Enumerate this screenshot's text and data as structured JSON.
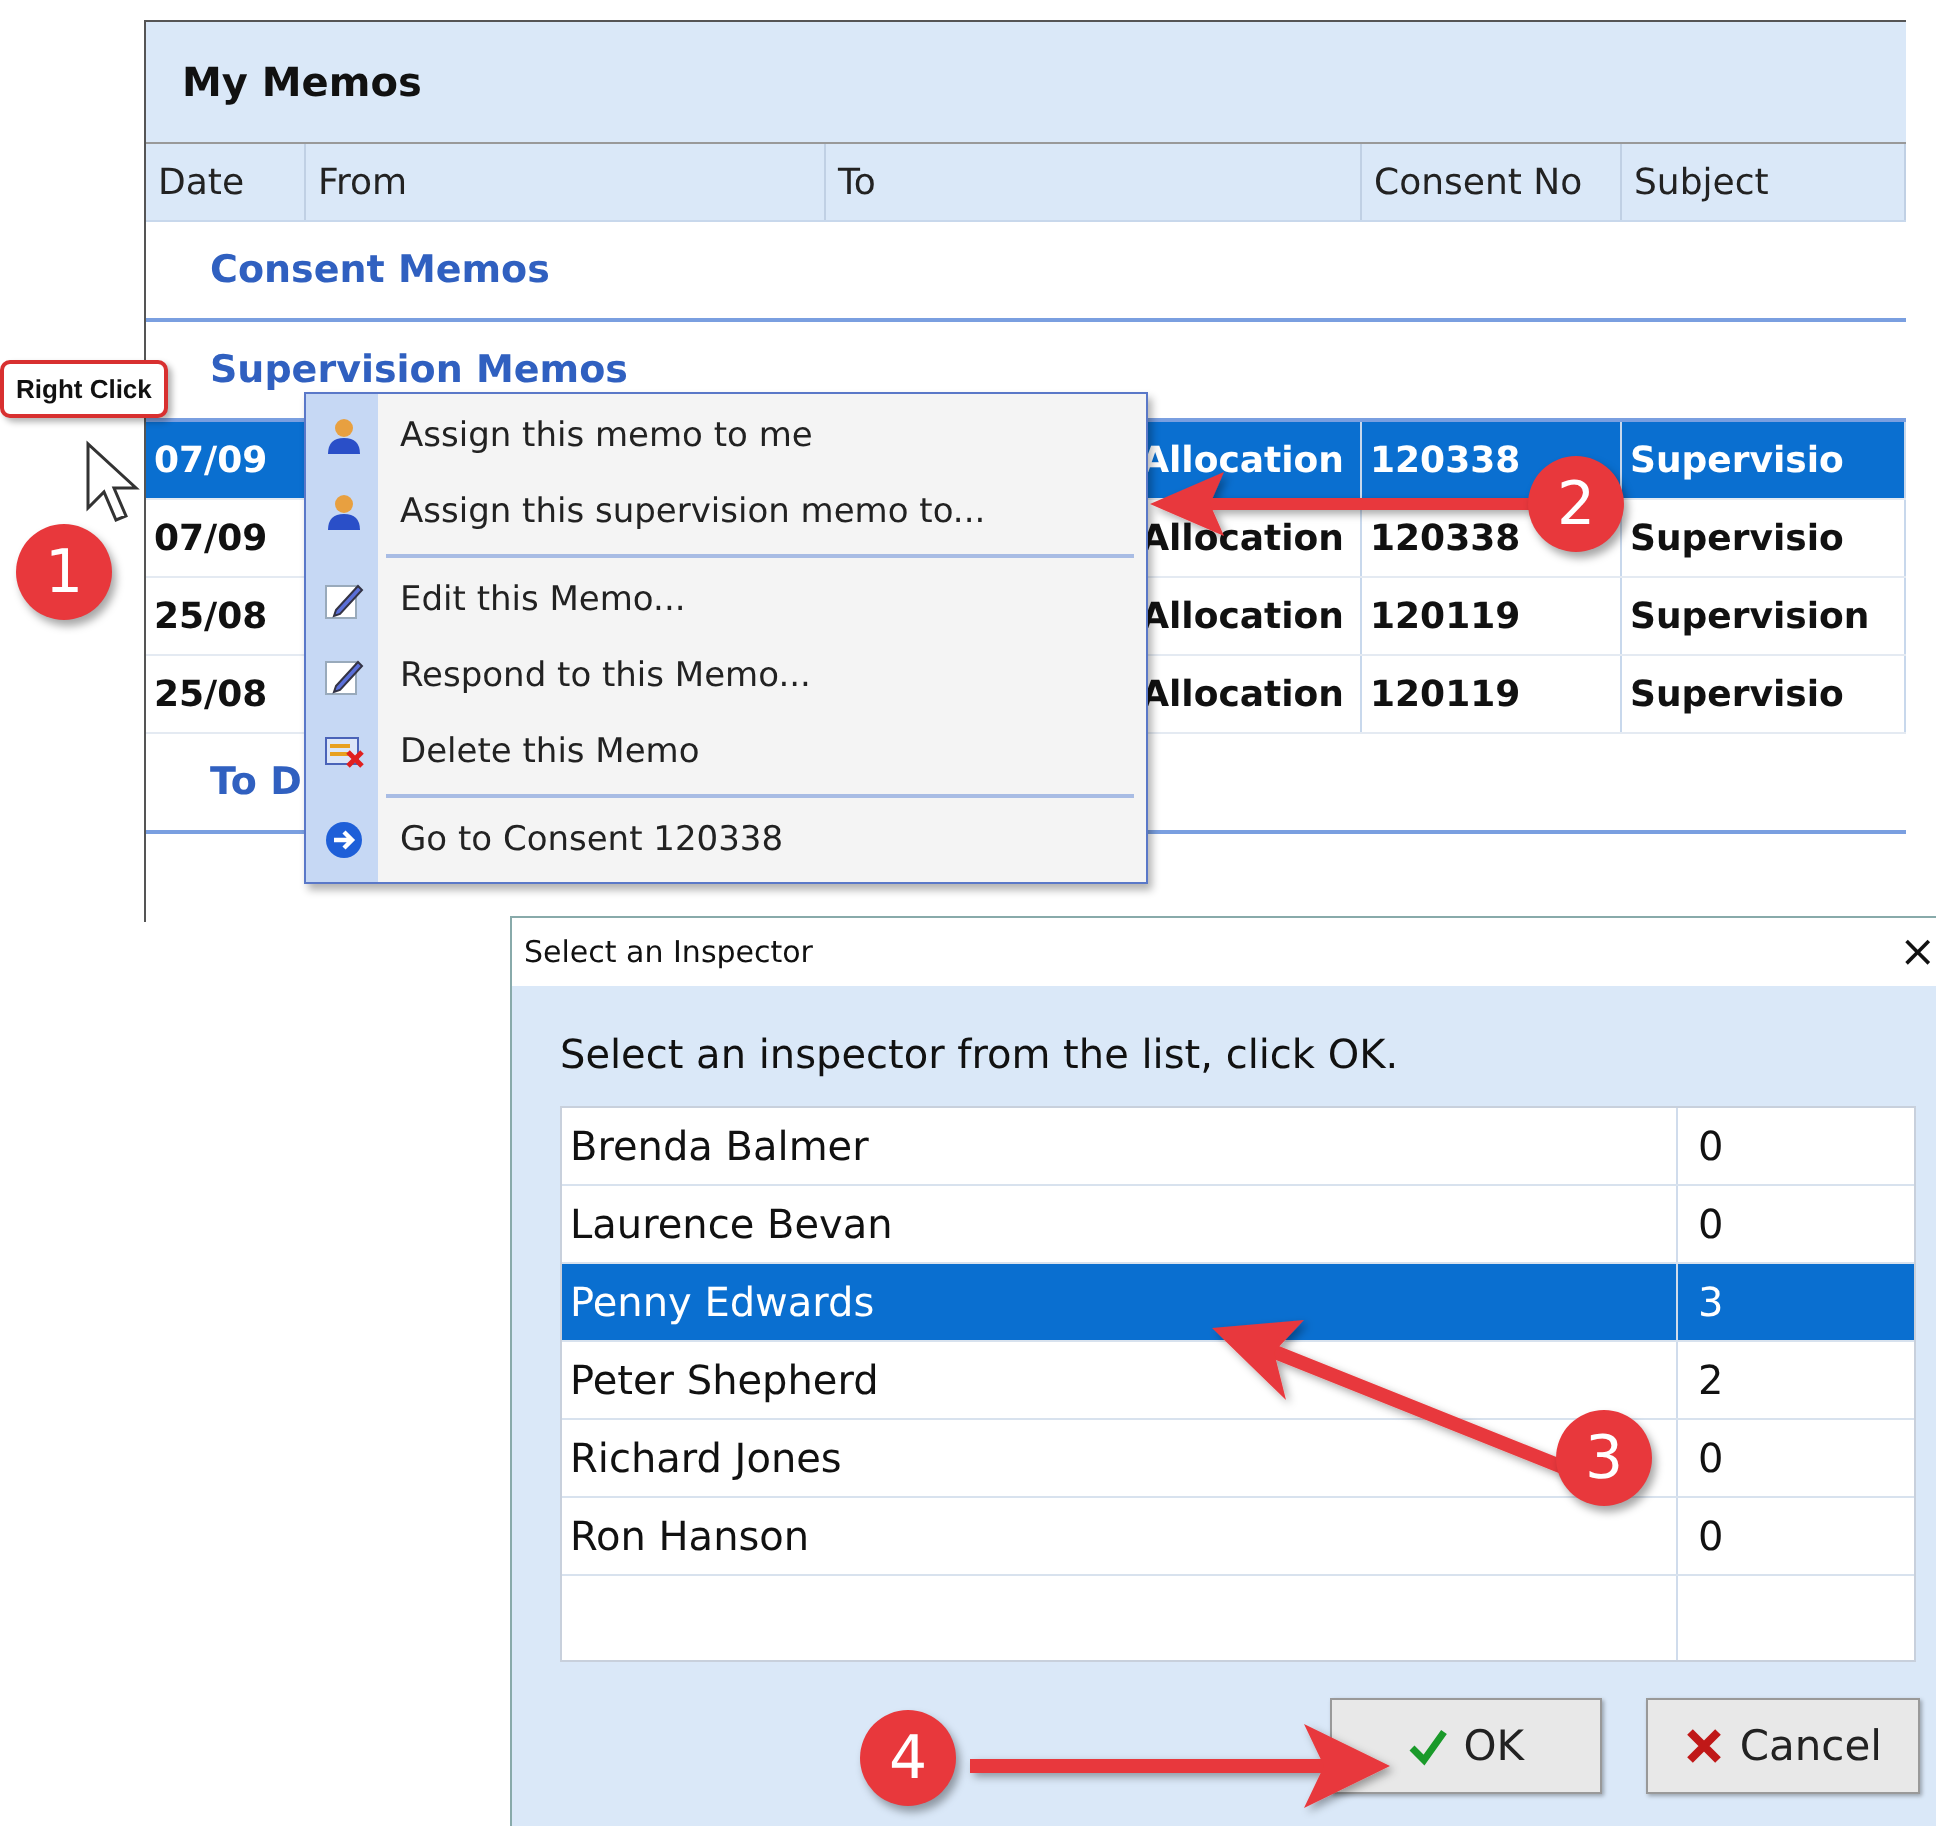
{
  "memos_panel": {
    "title": "My Memos",
    "columns": [
      "Date",
      "From",
      "To",
      "Consent No",
      "Subject"
    ],
    "groups": [
      {
        "label": "Consent Memos"
      },
      {
        "label": "Supervision Memos"
      }
    ],
    "rows": [
      {
        "date": "07/09",
        "to": "Allocation",
        "consent_no": "120338",
        "subject": "Supervisio",
        "selected": true
      },
      {
        "date": "07/09",
        "to": "Allocation",
        "consent_no": "120338",
        "subject": "Supervisio",
        "selected": false
      },
      {
        "date": "25/08",
        "to": "Allocation",
        "consent_no": "120119",
        "subject": "Supervision",
        "selected": false
      },
      {
        "date": "25/08",
        "to": "Allocation",
        "consent_no": "120119",
        "subject": "Supervisio",
        "selected": false
      }
    ],
    "trailing_group": "To D"
  },
  "context_menu": {
    "items": [
      {
        "kind": "person",
        "label": "Assign this memo to me"
      },
      {
        "kind": "person",
        "label": "Assign this supervision memo to..."
      },
      {
        "kind": "separator"
      },
      {
        "kind": "pencil",
        "label": "Edit this Memo..."
      },
      {
        "kind": "pencil",
        "label": "Respond to this Memo..."
      },
      {
        "kind": "delete",
        "label": "Delete this Memo"
      },
      {
        "kind": "separator"
      },
      {
        "kind": "goto",
        "label": "Go to Consent 120338"
      }
    ]
  },
  "dialog": {
    "title": "Select an Inspector",
    "close": "×",
    "instruction": "Select an inspector from the list, click OK.",
    "inspectors": [
      {
        "name": "Brenda Balmer",
        "count": "0",
        "selected": false
      },
      {
        "name": "Laurence Bevan",
        "count": "0",
        "selected": false
      },
      {
        "name": "Penny Edwards",
        "count": "3",
        "selected": true
      },
      {
        "name": "Peter Shepherd",
        "count": "2",
        "selected": false
      },
      {
        "name": "Richard Jones",
        "count": "0",
        "selected": false
      },
      {
        "name": "Ron Hanson",
        "count": "0",
        "selected": false
      }
    ],
    "buttons": [
      {
        "kind": "ok",
        "label": "OK"
      },
      {
        "kind": "cancel",
        "label": "Cancel"
      }
    ]
  },
  "annotations": {
    "callout": "Right Click",
    "steps": [
      "1",
      "2",
      "3",
      "4"
    ]
  }
}
